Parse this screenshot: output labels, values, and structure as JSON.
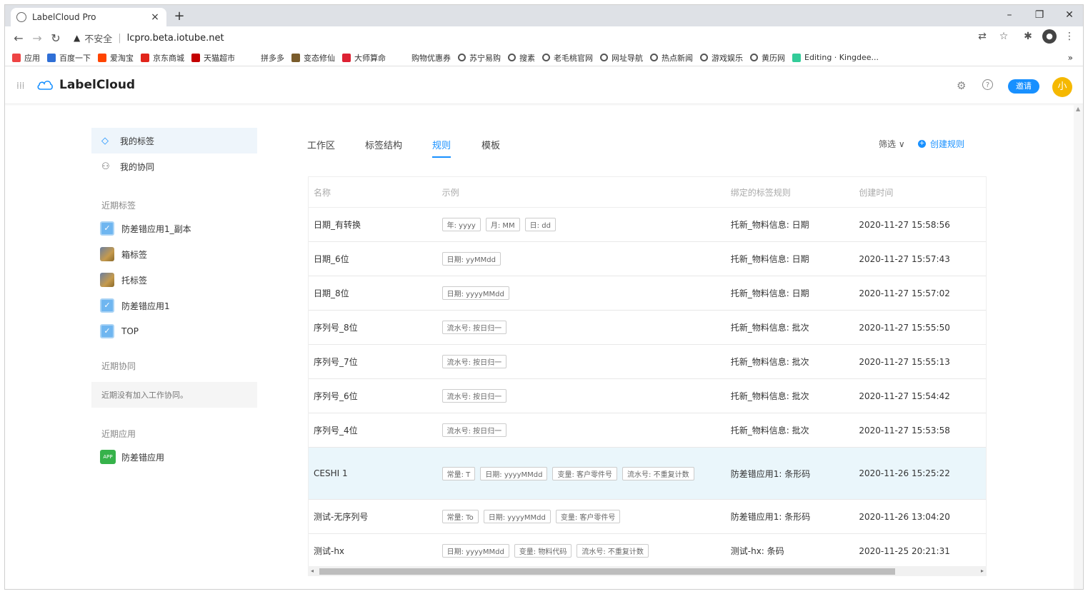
{
  "browser": {
    "tab_title": "LabelCloud Pro",
    "tab_close": "×",
    "new_tab": "+",
    "win_min": "–",
    "win_max": "❐",
    "win_close": "✕",
    "insecure_label": "不安全",
    "url": "lcpro.beta.iotube.net",
    "more_bookmarks": "»",
    "bookmarks": [
      {
        "label": "应用",
        "icon": "apps-grid-icon",
        "color": "#e44"
      },
      {
        "label": "百度一下",
        "icon": "baidu-icon",
        "color": "#2f6fd6"
      },
      {
        "label": "爱淘宝",
        "icon": "taobao-icon",
        "color": "#ff4400"
      },
      {
        "label": "京东商城",
        "icon": "jd-icon",
        "color": "#e1251b"
      },
      {
        "label": "天猫超市",
        "icon": "tmall-icon",
        "color": "#c40000"
      },
      {
        "label": "拼多多",
        "icon": "",
        "color": ""
      },
      {
        "label": "变态修仙",
        "icon": "game-icon",
        "color": "#7a5c2c"
      },
      {
        "label": "大师算命",
        "icon": "fortune-icon",
        "color": "#d23"
      },
      {
        "label": "购物优惠券",
        "icon": "",
        "color": ""
      },
      {
        "label": "苏宁易购",
        "icon": "globe-icon",
        "color": ""
      },
      {
        "label": "搜素",
        "icon": "globe-icon",
        "color": ""
      },
      {
        "label": "老毛桃官网",
        "icon": "globe-icon",
        "color": ""
      },
      {
        "label": "网址导航",
        "icon": "globe-icon",
        "color": ""
      },
      {
        "label": "热点新闻",
        "icon": "globe-icon",
        "color": ""
      },
      {
        "label": "游戏娱乐",
        "icon": "globe-icon",
        "color": ""
      },
      {
        "label": "黄历网",
        "icon": "globe-icon",
        "color": ""
      },
      {
        "label": "Editing · Kingdee...",
        "icon": "edit-icon",
        "color": "#3c9"
      }
    ]
  },
  "app": {
    "brand": "LabelCloud",
    "invite": "邀请",
    "avatar": "小"
  },
  "sidebar": {
    "my_labels": "我的标签",
    "my_collab": "我的协同",
    "recent_labels_title": "近期标签",
    "recent_labels": [
      {
        "label": "防差错应用1_副本",
        "icon": "checkbox-icon"
      },
      {
        "label": "箱标签",
        "icon": "image-icon"
      },
      {
        "label": "托标签",
        "icon": "image-icon"
      },
      {
        "label": "防差错应用1",
        "icon": "checkbox-icon"
      },
      {
        "label": "TOP",
        "icon": "checkbox-icon"
      }
    ],
    "recent_collab_title": "近期协同",
    "recent_collab_empty": "近期没有加入工作协同。",
    "recent_apps_title": "近期应用",
    "app_badge": "APP",
    "recent_app": "防差错应用"
  },
  "main": {
    "tabs": [
      "工作区",
      "标签结构",
      "规则",
      "模板"
    ],
    "active_tab": "规则",
    "filter": "筛选 ∨",
    "create": "创建规则",
    "columns": [
      "名称",
      "示例",
      "绑定的标签规则",
      "创建时间"
    ],
    "rows": [
      {
        "name": "日期_有转换",
        "chips": [
          "年: yyyy",
          "月: MM",
          "日: dd"
        ],
        "binding": "托新_物料信息:  日期",
        "time": "2020-11-27 15:58:56"
      },
      {
        "name": "日期_6位",
        "chips": [
          "日期: yyMMdd"
        ],
        "binding": "托新_物料信息:  日期",
        "time": "2020-11-27 15:57:43"
      },
      {
        "name": "日期_8位",
        "chips": [
          "日期: yyyyMMdd"
        ],
        "binding": "托新_物料信息:  日期",
        "time": "2020-11-27 15:57:02"
      },
      {
        "name": "序列号_8位",
        "chips": [
          "流水号: 按日归一"
        ],
        "binding": "托新_物料信息:  批次",
        "time": "2020-11-27 15:55:50"
      },
      {
        "name": "序列号_7位",
        "chips": [
          "流水号: 按日归一"
        ],
        "binding": "托新_物料信息:  批次",
        "time": "2020-11-27 15:55:13"
      },
      {
        "name": "序列号_6位",
        "chips": [
          "流水号: 按日归一"
        ],
        "binding": "托新_物料信息:  批次",
        "time": "2020-11-27 15:54:42"
      },
      {
        "name": "序列号_4位",
        "chips": [
          "流水号: 按日归一"
        ],
        "binding": "托新_物料信息:  批次",
        "time": "2020-11-27 15:53:58"
      },
      {
        "name": "CESHI 1",
        "chips": [
          "常量: T",
          "日期: yyyyMMdd",
          "变量: 客户零件号",
          "流水号: 不重复计数"
        ],
        "binding": "防差错应用1:  条形码",
        "time": "2020-11-26 15:25:22"
      },
      {
        "name": "测试-无序列号",
        "chips": [
          "常量: To",
          "日期: yyyyMMdd",
          "变量: 客户零件号"
        ],
        "binding": "防差错应用1:  条形码",
        "time": "2020-11-26 13:04:20"
      },
      {
        "name": "测试-hx",
        "chips": [
          "日期: yyyyMMdd",
          "变量: 物料代码",
          "流水号: 不重复计数"
        ],
        "binding": "测试-hx:  条码",
        "time": "2020-11-25 20:21:31"
      }
    ]
  }
}
